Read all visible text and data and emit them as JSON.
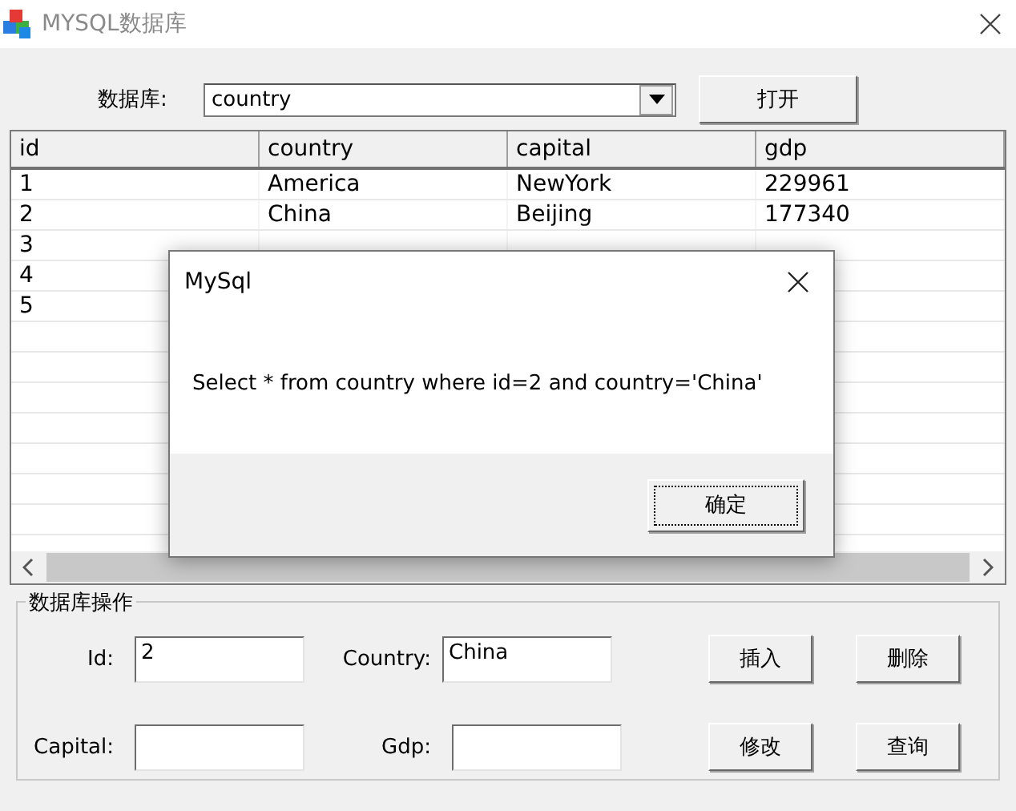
{
  "window": {
    "title": "MYSQL数据库"
  },
  "database_selector": {
    "label": "数据库:",
    "value": "country"
  },
  "open_button": "打开",
  "table": {
    "columns": [
      "id",
      "country",
      "capital",
      "gdp"
    ],
    "rows": [
      [
        "1",
        "America",
        "NewYork",
        "229961"
      ],
      [
        "2",
        "China",
        "Beijing",
        "177340"
      ],
      [
        "3"
      ],
      [
        "4"
      ],
      [
        "5"
      ]
    ]
  },
  "operations": {
    "title": "数据库操作",
    "fields": [
      {
        "label": "Id:",
        "value": "2"
      },
      {
        "label": "Country:",
        "value": "China"
      },
      {
        "label": "Capital:"
      },
      {
        "label": "Gdp:"
      }
    ],
    "buttons": [
      "插入",
      "删除",
      "修改",
      "查询"
    ]
  },
  "dialog": {
    "title": "MySql",
    "message": "Select * from country where id=2 and country='China'",
    "button": "确定"
  }
}
